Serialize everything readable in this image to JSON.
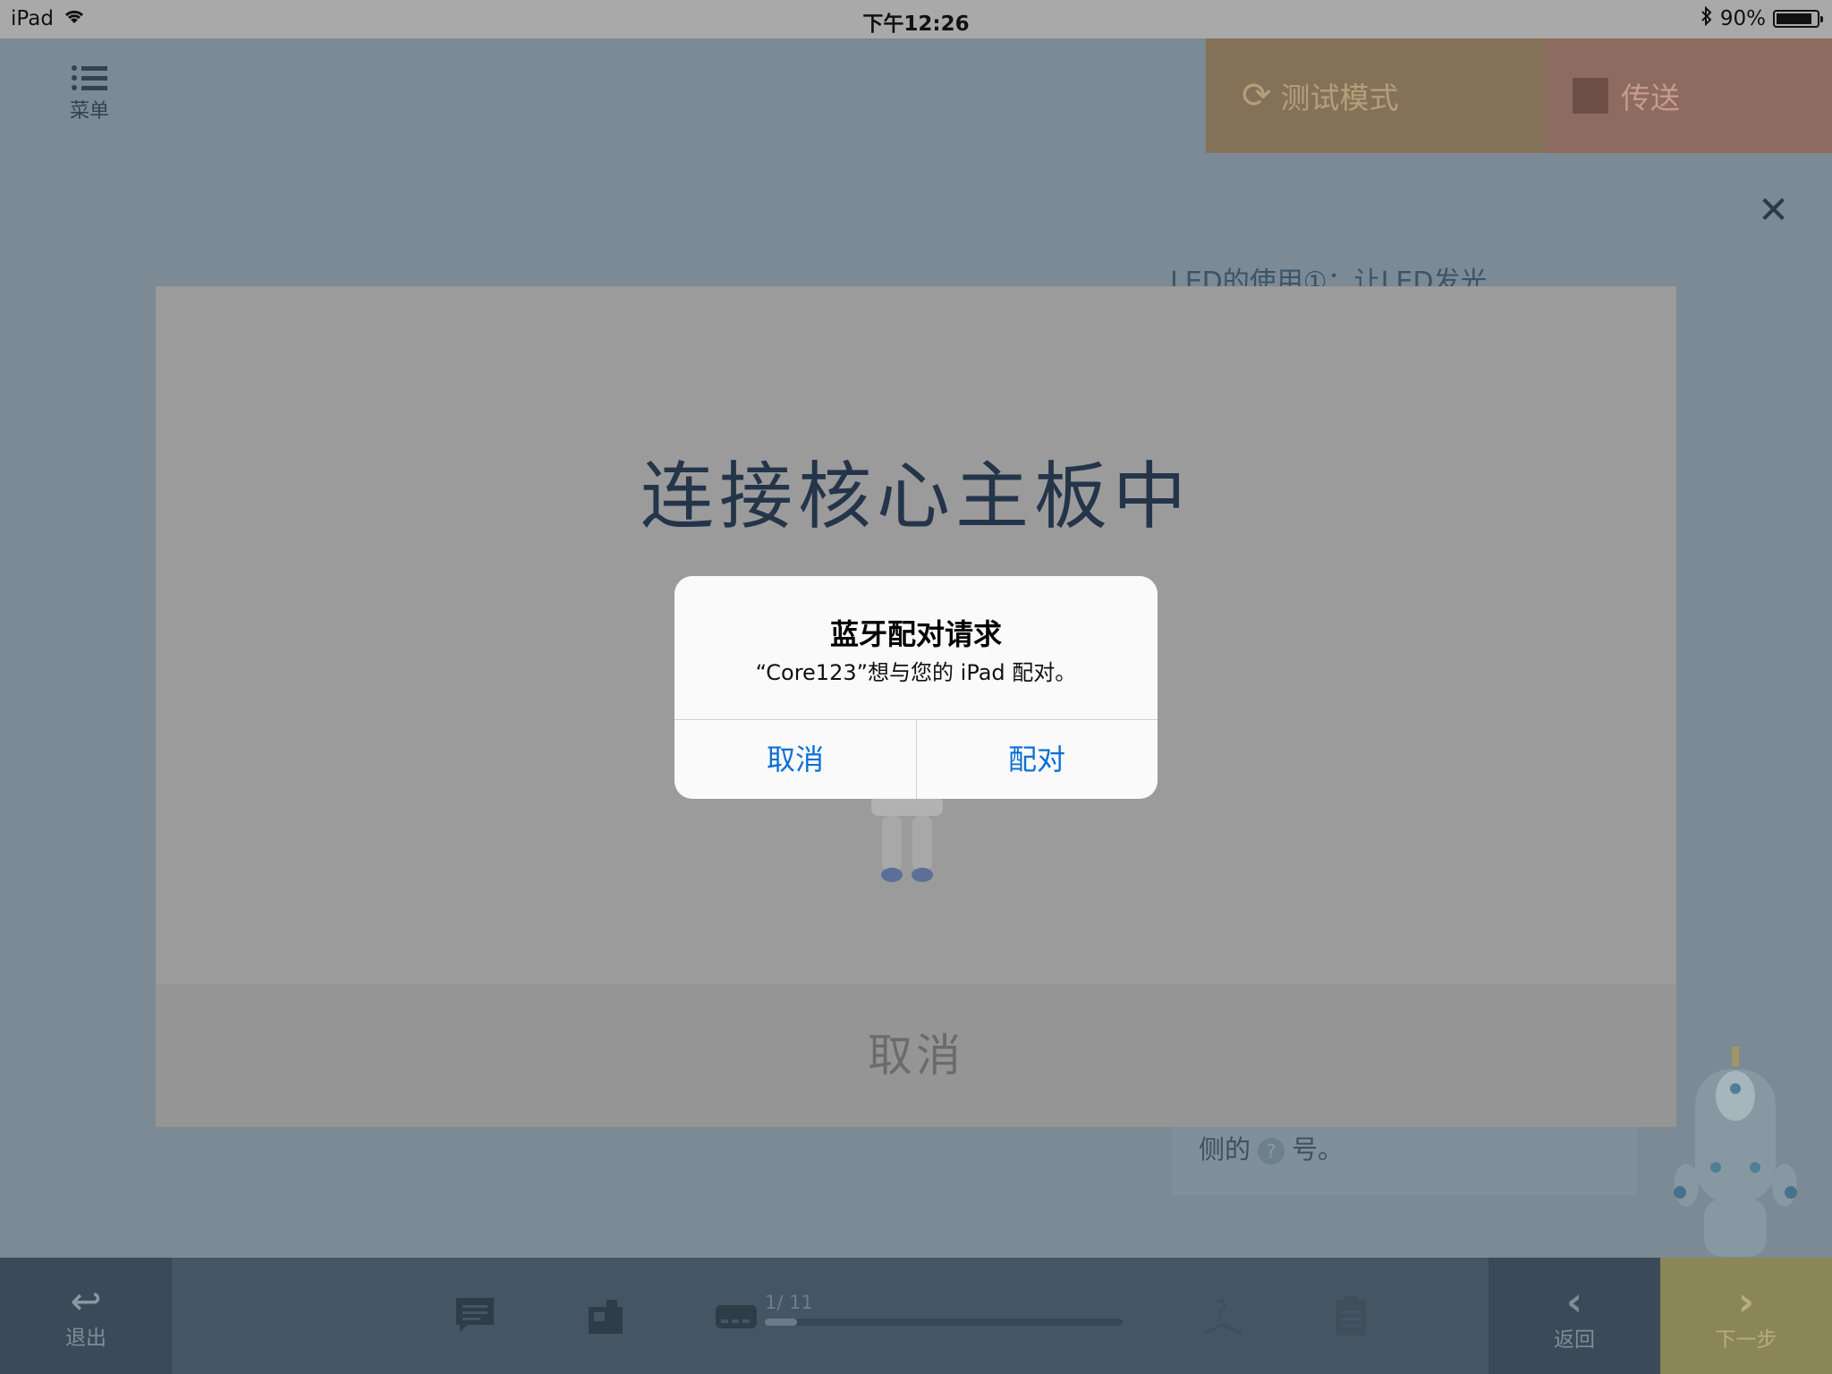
{
  "status_bar": {
    "device": "iPad",
    "time": "下午12:26",
    "battery": "90%",
    "battery_level": 0.9
  },
  "app": {
    "menu_label": "菜单",
    "test_mode_label": "测试模式",
    "send_label": "传送",
    "lesson_title": "LED的使用①：让LED发光",
    "hint_prefix": "侧的",
    "hint_q": "?",
    "hint_suffix": "号。",
    "progress_text": "1/ 11",
    "progress_value": 0.0909,
    "exit_label": "退出",
    "back_label": "返回",
    "next_label": "下一步",
    "colors": {
      "test_mode": "#847258",
      "send": "#8d6b60",
      "next": "#8b8657",
      "toolbar": "#445564"
    }
  },
  "connect_modal": {
    "title": "连接核心主板中",
    "cancel_label": "取消"
  },
  "alert": {
    "title": "蓝牙配对请求",
    "message": "“Core123”想与您的 iPad 配对。",
    "cancel_label": "取消",
    "pair_label": "配对",
    "button_color": "#0a6fd6"
  }
}
